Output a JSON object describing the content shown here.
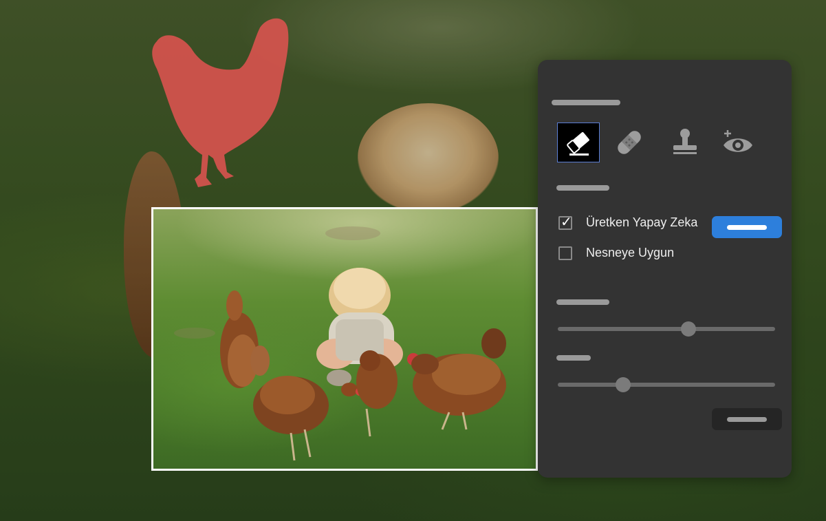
{
  "panel": {
    "tools": [
      {
        "icon": "eraser-icon",
        "active": true
      },
      {
        "icon": "bandage-icon",
        "active": false
      },
      {
        "icon": "stamp-icon",
        "active": false
      },
      {
        "icon": "eye-add-icon",
        "active": false
      }
    ],
    "options": {
      "generative_ai": {
        "label": "Üretken Yapay Zeka",
        "checked": true
      },
      "object_aware": {
        "label": "Nesneye Uygun",
        "checked": false
      }
    },
    "sliders": [
      {
        "value": 0.6
      },
      {
        "value": 0.3
      }
    ]
  },
  "colors": {
    "mask": "#d9534f",
    "accent": "#2d7fdc",
    "panel_bg": "#333333"
  }
}
